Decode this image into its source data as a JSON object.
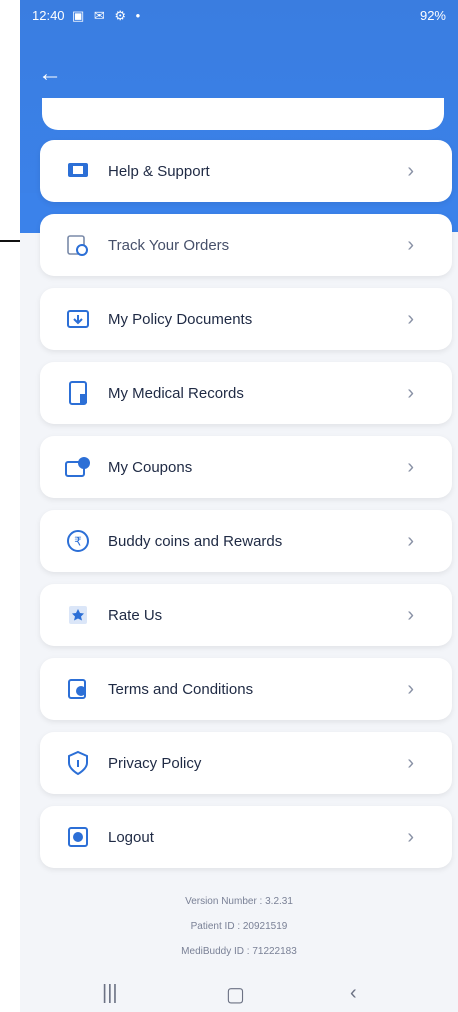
{
  "status": {
    "time": "12:40",
    "icons": "▣ ✉ ⚙ •",
    "right": "92%"
  },
  "header": {
    "back_icon": "arrow-left-icon"
  },
  "menu": {
    "items": [
      {
        "label": "Help & Support",
        "icon": "help-support-icon"
      },
      {
        "label": "Track Your Orders",
        "icon": "track-orders-icon"
      },
      {
        "label": "My Policy Documents",
        "icon": "policy-docs-icon"
      },
      {
        "label": "My Medical Records",
        "icon": "medical-records-icon"
      },
      {
        "label": "My Coupons",
        "icon": "coupons-icon"
      },
      {
        "label": "Buddy coins and Rewards",
        "icon": "rewards-icon"
      },
      {
        "label": "Rate Us",
        "icon": "rate-us-icon"
      },
      {
        "label": "Terms and Conditions",
        "icon": "terms-icon"
      },
      {
        "label": "Privacy Policy",
        "icon": "privacy-icon"
      },
      {
        "label": "Logout",
        "icon": "logout-icon"
      }
    ]
  },
  "footer": {
    "version": "Version Number : 3.2.31",
    "patient_id": "Patient ID : 20921519",
    "medibuddy_id": "MediBuddy ID : 71222183"
  },
  "colors": {
    "brand": "#3b82ea",
    "icon_blue": "#2c6fd6"
  }
}
